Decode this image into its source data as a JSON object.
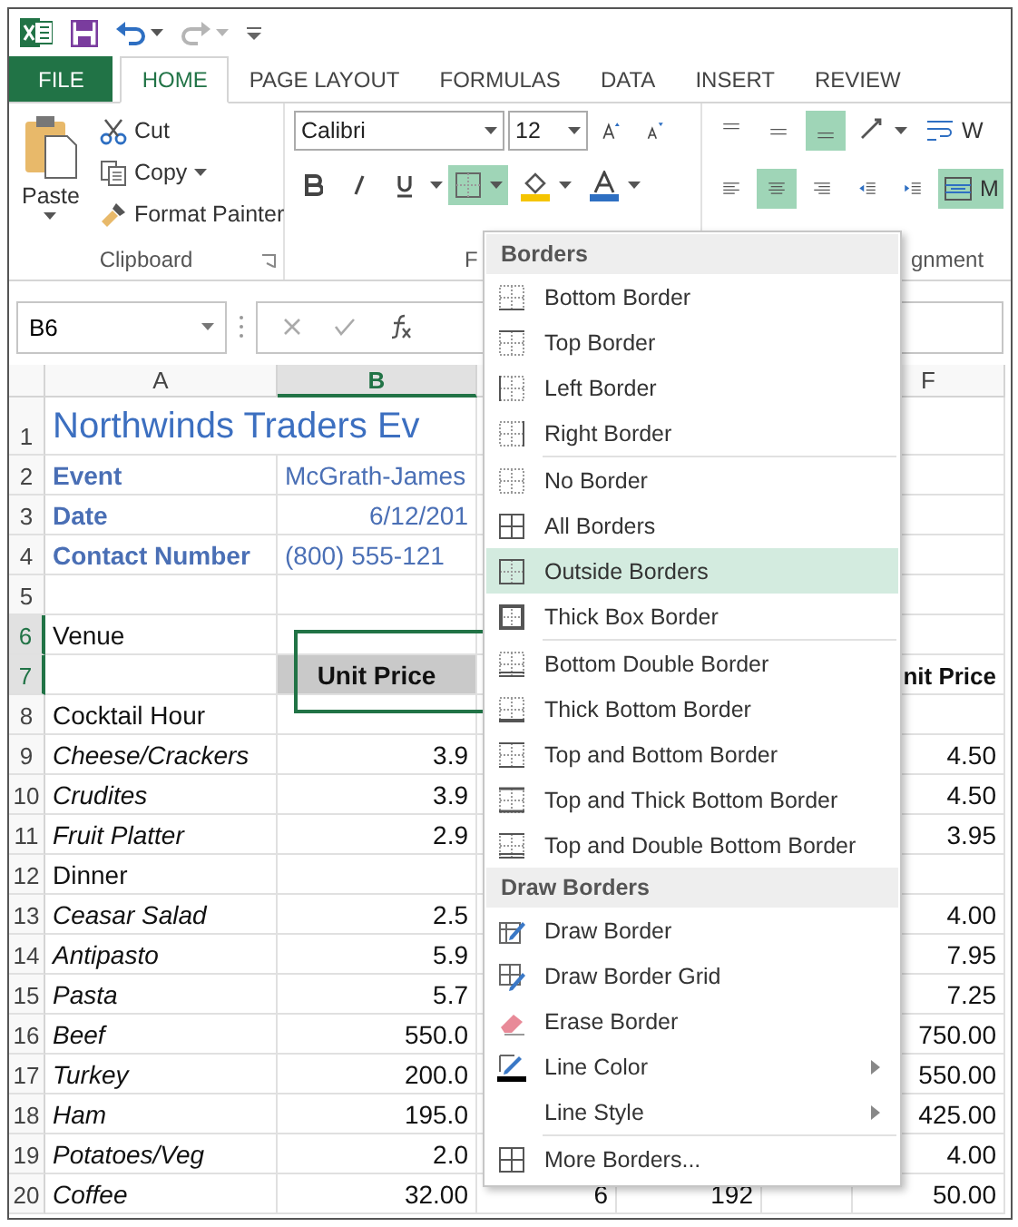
{
  "tabs": [
    {
      "label": "FILE",
      "selected": false,
      "kind": "file"
    },
    {
      "label": "HOME",
      "selected": true,
      "kind": "tab"
    },
    {
      "label": "PAGE LAYOUT",
      "selected": false,
      "kind": "tab"
    },
    {
      "label": "FORMULAS",
      "selected": false,
      "kind": "tab"
    },
    {
      "label": "DATA",
      "selected": false,
      "kind": "tab"
    },
    {
      "label": "INSERT",
      "selected": false,
      "kind": "tab"
    },
    {
      "label": "REVIEW",
      "selected": false,
      "kind": "tab"
    }
  ],
  "ribbon": {
    "clipboard": {
      "paste": "Paste",
      "cut": "Cut",
      "copy": "Copy",
      "format_painter": "Format Painter",
      "label": "Clipboard"
    },
    "font": {
      "name": "Calibri",
      "size": "12",
      "label": "F",
      "bold": false,
      "italic": false,
      "underline": false,
      "borders_active": true
    },
    "alignment": {
      "bottom_align_active": true,
      "center_active": true,
      "wrap_text": "W",
      "merge": "M",
      "label": "gnment"
    }
  },
  "formula_bar": {
    "name_box": "B6"
  },
  "columns": [
    {
      "label": "A",
      "selected": false
    },
    {
      "label": "B",
      "selected": true
    },
    {
      "label": "F",
      "selected": false
    }
  ],
  "rows": [
    {
      "num": "1",
      "selected": false,
      "kind": "title",
      "a": "Northwinds Traders Ev"
    },
    {
      "num": "2",
      "selected": false,
      "kind": "info",
      "a": "Event",
      "b": "McGrath-James"
    },
    {
      "num": "3",
      "selected": false,
      "kind": "date",
      "a": "Date",
      "b": "6/12/201"
    },
    {
      "num": "4",
      "selected": false,
      "kind": "info",
      "a": "Contact Number",
      "b": "(800) 555-121"
    },
    {
      "num": "5",
      "selected": false,
      "kind": "blank"
    },
    {
      "num": "6",
      "selected": true,
      "kind": "section",
      "a": "Venue"
    },
    {
      "num": "7",
      "selected": true,
      "kind": "header",
      "b": "Unit Price",
      "f": "nit Price"
    },
    {
      "num": "8",
      "selected": false,
      "kind": "section",
      "a": "Cocktail Hour"
    },
    {
      "num": "9",
      "selected": false,
      "kind": "item",
      "a": "Cheese/Crackers",
      "b": "3.9",
      "f": "4.50"
    },
    {
      "num": "10",
      "selected": false,
      "kind": "item",
      "a": "Crudites",
      "b": "3.9",
      "f": "4.50"
    },
    {
      "num": "11",
      "selected": false,
      "kind": "item",
      "a": "Fruit Platter",
      "b": "2.9",
      "f": "3.95"
    },
    {
      "num": "12",
      "selected": false,
      "kind": "section",
      "a": "Dinner"
    },
    {
      "num": "13",
      "selected": false,
      "kind": "item",
      "a": "Ceasar Salad",
      "b": "2.5",
      "f": "4.00"
    },
    {
      "num": "14",
      "selected": false,
      "kind": "item",
      "a": "Antipasto",
      "b": "5.9",
      "f": "7.95"
    },
    {
      "num": "15",
      "selected": false,
      "kind": "item",
      "a": "Pasta",
      "b": "5.7",
      "f": "7.25"
    },
    {
      "num": "16",
      "selected": false,
      "kind": "item",
      "a": "Beef",
      "b": "550.0",
      "f": "750.00"
    },
    {
      "num": "17",
      "selected": false,
      "kind": "item",
      "a": "Turkey",
      "b": "200.0",
      "f": "550.00"
    },
    {
      "num": "18",
      "selected": false,
      "kind": "item",
      "a": "Ham",
      "b": "195.0",
      "f": "425.00"
    },
    {
      "num": "19",
      "selected": false,
      "kind": "item",
      "a": "Potatoes/Veg",
      "b": "2.0",
      "f": "4.00"
    },
    {
      "num": "20",
      "selected": false,
      "kind": "item",
      "a": "Coffee",
      "b": "32.00",
      "c": "6",
      "d": "192",
      "f": "50.00"
    }
  ],
  "borders_menu": {
    "sections": [
      {
        "title": "Borders",
        "items": [
          {
            "label": "Bottom Border",
            "selected": false,
            "separator_before": false,
            "submenu": false
          },
          {
            "label": "Top Border",
            "selected": false,
            "separator_before": false,
            "submenu": false
          },
          {
            "label": "Left Border",
            "selected": false,
            "separator_before": false,
            "submenu": false
          },
          {
            "label": "Right Border",
            "selected": false,
            "separator_before": false,
            "submenu": false
          },
          {
            "label": "No Border",
            "selected": false,
            "separator_before": true,
            "submenu": false
          },
          {
            "label": "All Borders",
            "selected": false,
            "separator_before": false,
            "submenu": false
          },
          {
            "label": "Outside Borders",
            "selected": true,
            "separator_before": false,
            "submenu": false
          },
          {
            "label": "Thick Box Border",
            "selected": false,
            "separator_before": false,
            "submenu": false
          },
          {
            "label": "Bottom Double Border",
            "selected": false,
            "separator_before": true,
            "submenu": false
          },
          {
            "label": "Thick Bottom Border",
            "selected": false,
            "separator_before": false,
            "submenu": false
          },
          {
            "label": "Top and Bottom Border",
            "selected": false,
            "separator_before": false,
            "submenu": false
          },
          {
            "label": "Top and Thick Bottom Border",
            "selected": false,
            "separator_before": false,
            "submenu": false
          },
          {
            "label": "Top and Double Bottom Border",
            "selected": false,
            "separator_before": false,
            "submenu": false
          }
        ]
      },
      {
        "title": "Draw Borders",
        "items": [
          {
            "label": "Draw Border",
            "selected": false,
            "separator_before": false,
            "submenu": false
          },
          {
            "label": "Draw Border Grid",
            "selected": false,
            "separator_before": false,
            "submenu": false
          },
          {
            "label": "Erase Border",
            "selected": false,
            "separator_before": false,
            "submenu": false
          },
          {
            "label": "Line Color",
            "selected": false,
            "separator_before": false,
            "submenu": true
          },
          {
            "label": "Line Style",
            "selected": false,
            "separator_before": false,
            "submenu": true
          },
          {
            "label": "More Borders...",
            "selected": false,
            "separator_before": true,
            "submenu": false
          }
        ]
      }
    ]
  }
}
